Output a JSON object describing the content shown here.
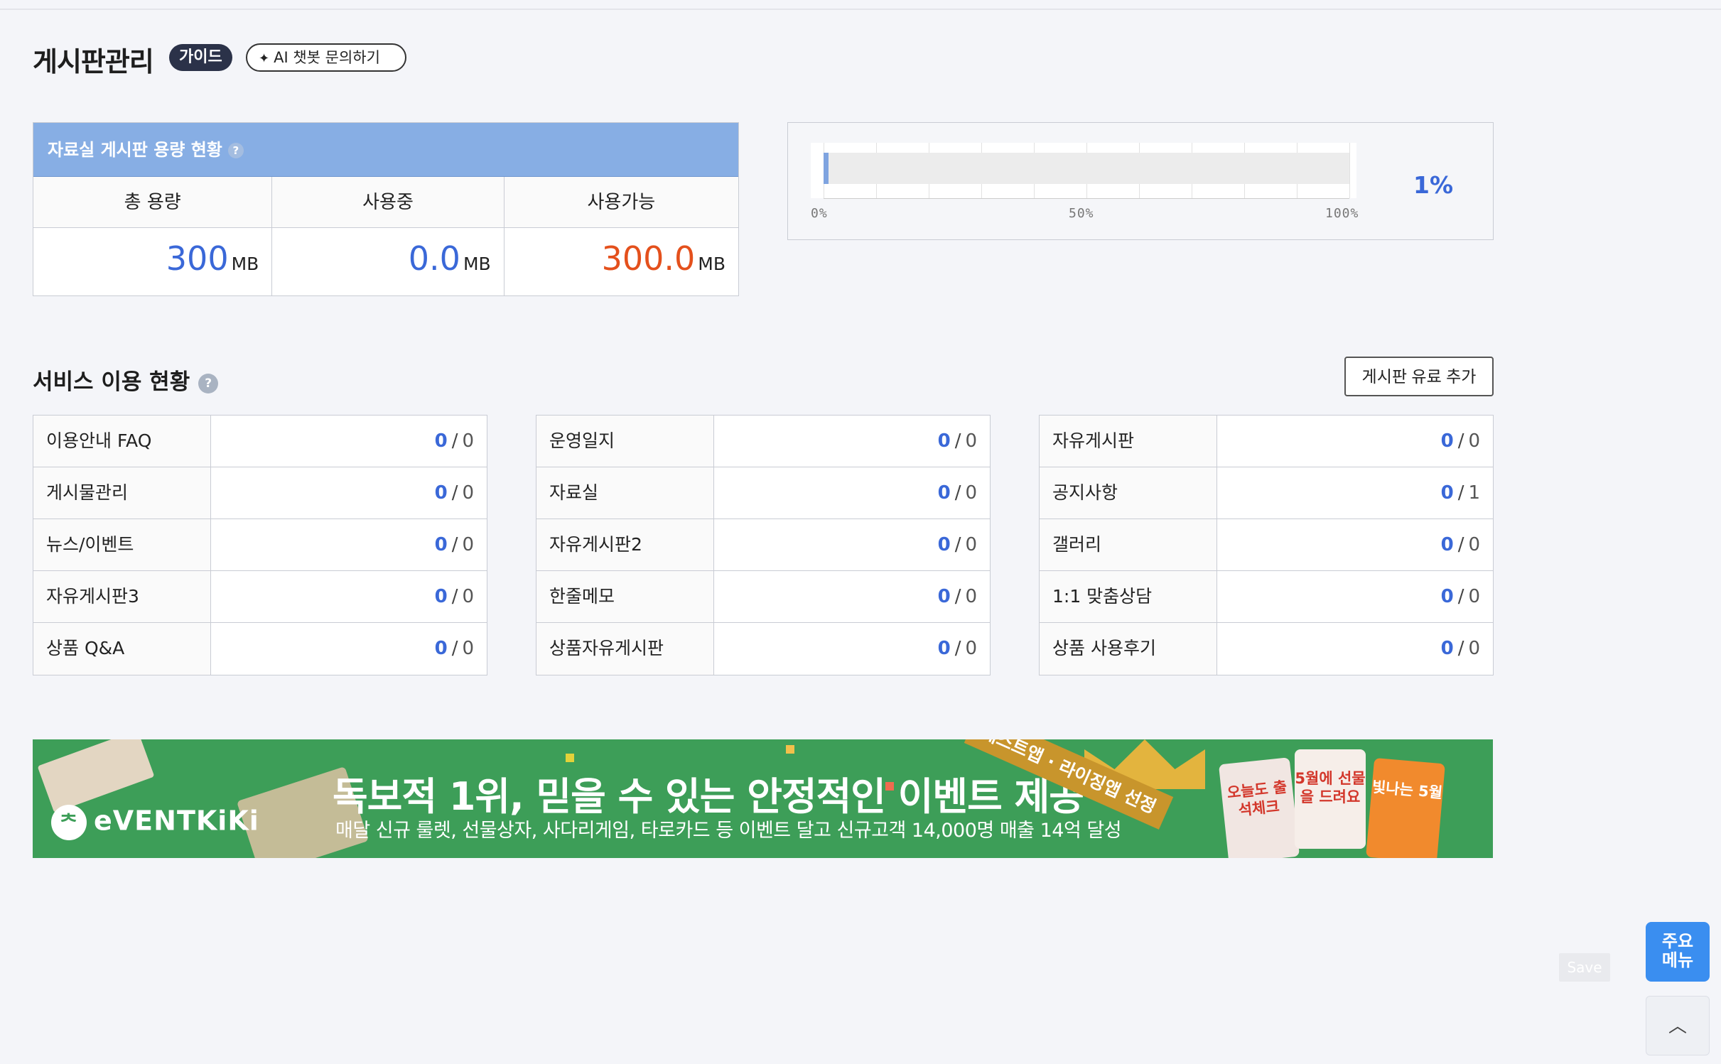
{
  "header": {
    "title": "게시판관리",
    "guide_label": "가이드",
    "ai_button_label": "AI 챗봇 문의하기",
    "help_icon": "?"
  },
  "capacity": {
    "section_title": "자료실 게시판 용량 현황",
    "columns": [
      "총 용량",
      "사용중",
      "사용가능"
    ],
    "values": [
      {
        "value": "300",
        "unit": "MB"
      },
      {
        "value": "0.0",
        "unit": "MB"
      },
      {
        "value": "300.0",
        "unit": "MB"
      }
    ],
    "colors": {
      "total": "#3a68d8",
      "used": "#3a68d8",
      "available": "#e4501c"
    }
  },
  "usage_chart": {
    "percent_label": "1%",
    "chart_data": {
      "type": "bar",
      "orientation": "horizontal",
      "values": [
        1
      ],
      "xlim": [
        0,
        100
      ],
      "tick_labels": [
        "0%",
        "50%",
        "100%"
      ],
      "bar_color": "#7fa4e0"
    }
  },
  "services": {
    "section_title": "서비스 이용 현황",
    "add_button_label": "게시판 유료 추가",
    "separator": "/",
    "columns": [
      [
        {
          "name": "이용안내 FAQ",
          "used": "0",
          "total": "0"
        },
        {
          "name": "게시물관리",
          "used": "0",
          "total": "0"
        },
        {
          "name": "뉴스/이벤트",
          "used": "0",
          "total": "0"
        },
        {
          "name": "자유게시판3",
          "used": "0",
          "total": "0"
        },
        {
          "name": "상품 Q&A",
          "used": "0",
          "total": "0"
        }
      ],
      [
        {
          "name": "운영일지",
          "used": "0",
          "total": "0"
        },
        {
          "name": "자료실",
          "used": "0",
          "total": "0"
        },
        {
          "name": "자유게시판2",
          "used": "0",
          "total": "0"
        },
        {
          "name": "한줄메모",
          "used": "0",
          "total": "0"
        },
        {
          "name": "상품자유게시판",
          "used": "0",
          "total": "0"
        }
      ],
      [
        {
          "name": "자유게시판",
          "used": "0",
          "total": "0"
        },
        {
          "name": "공지사항",
          "used": "0",
          "total": "1"
        },
        {
          "name": "갤러리",
          "used": "0",
          "total": "0"
        },
        {
          "name": "1:1 맞춤상담",
          "used": "0",
          "total": "0"
        },
        {
          "name": "상품 사용후기",
          "used": "0",
          "total": "0"
        }
      ]
    ]
  },
  "banner": {
    "logo_text": "eVENTKiKi",
    "headline": "독보적 1위, 믿을 수 있는 안정적인 이벤트 제공",
    "subline": "매달 신규 룰렛, 선물상자, 사다리게임, 타로카드 등 이벤트 달고 신규고객 14,000명 매출 14억 달성",
    "ribbon": "베스트앱 · 라이징앱 선정",
    "card1": "오늘도 출석체크",
    "card2": "5월에 선물을 드려요",
    "card3": "빛나는 5월"
  },
  "floating": {
    "save_label": "Save",
    "menu_label_line1": "주요",
    "menu_label_line2": "메뉴",
    "top_icon": "chevron-up-icon"
  }
}
